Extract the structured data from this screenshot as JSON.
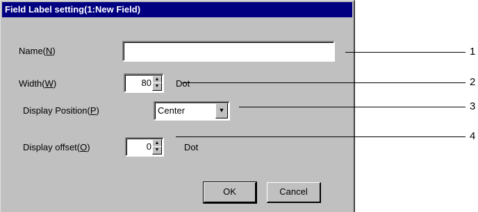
{
  "dialog": {
    "title": "Field Label setting(1:New Field)",
    "name": {
      "label": "Name(",
      "mnemonic": "N",
      "label_end": ")",
      "value": ""
    },
    "width": {
      "label": "Width(",
      "mnemonic": "W",
      "label_end": ")",
      "value": "80",
      "unit": "Dot"
    },
    "position": {
      "label": "Display Position(",
      "mnemonic": "P",
      "label_end": ")",
      "value": "Center"
    },
    "offset": {
      "label": "Display offset(",
      "mnemonic": "O",
      "label_end": ")",
      "value": "0",
      "unit": "Dot"
    },
    "ok_label": "OK",
    "cancel_label": "Cancel"
  },
  "callouts": [
    "1",
    "2",
    "3",
    "4"
  ]
}
